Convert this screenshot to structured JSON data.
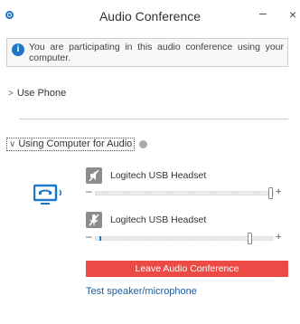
{
  "window": {
    "title": "Audio Conference",
    "minimize_label": "–",
    "close_label": "×"
  },
  "info": {
    "icon_glyph": "i",
    "text": "You are participating in this audio conference using your computer."
  },
  "use_phone": {
    "chevron": ">",
    "label": "Use Phone"
  },
  "computer_section": {
    "chevron": "∨",
    "label": "Using Computer for Audio"
  },
  "devices": {
    "speaker": {
      "label": "Logitech USB Headset",
      "icon": "speaker-muted-icon",
      "minus": "–",
      "plus": "+",
      "volume_fraction": 0.99
    },
    "microphone": {
      "label": "Logitech USB Headset",
      "icon": "microphone-muted-icon",
      "minus": "–",
      "plus": "+",
      "volume_fraction": 0.87,
      "input_level_fraction": 0.02
    }
  },
  "actions": {
    "leave_label": "Leave Audio Conference",
    "test_label": "Test speaker/microphone"
  },
  "colors": {
    "accent": "#1e78c8",
    "danger": "#ec4a44",
    "link": "#1f5c99"
  }
}
